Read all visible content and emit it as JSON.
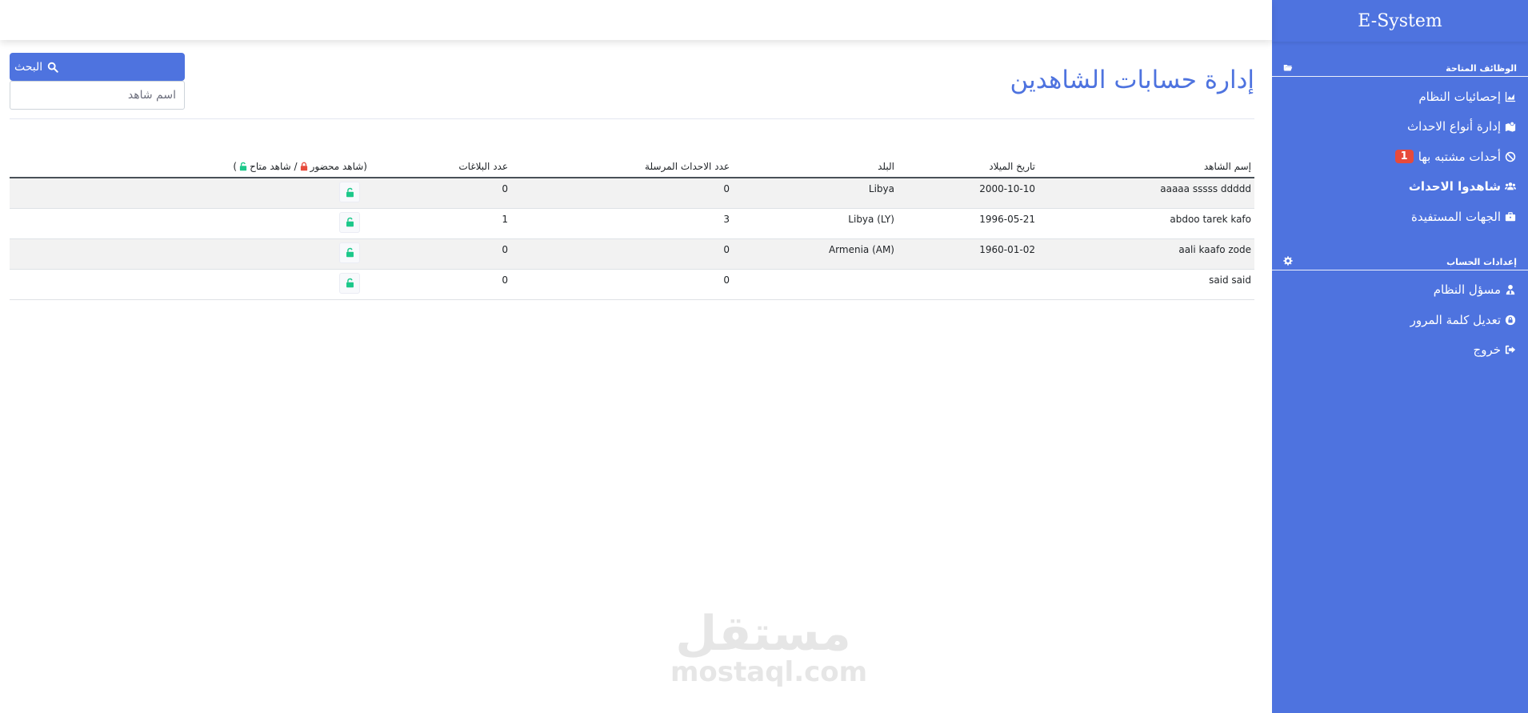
{
  "app": {
    "brand": "E-System"
  },
  "sidebar": {
    "section_functions": "الوظائف المتاحة",
    "items": [
      {
        "label": "إحصائيات النظام",
        "icon": "chart-area-icon"
      },
      {
        "label": "إدارة أنواع الاحداث",
        "icon": "map-marked-icon"
      },
      {
        "label": "أحدات مشتبه بها",
        "icon": "ban-icon",
        "badge": "1"
      },
      {
        "label": "شاهدوا الاحداث",
        "icon": "users-icon",
        "active": true
      },
      {
        "label": "الجهات المستفيدة",
        "icon": "briefcase-icon"
      }
    ],
    "section_account": "إعدادات الحساب",
    "account_items": [
      {
        "label": "مسؤل النظام",
        "icon": "user-tie-icon"
      },
      {
        "label": "تعديل كلمة المرور",
        "icon": "lock-circle-icon"
      },
      {
        "label": "خروج",
        "icon": "sign-out-icon"
      }
    ]
  },
  "page": {
    "title": "إدارة حسابات الشاهدين",
    "search_button": "البحث",
    "search_placeholder": "اسم شاهد"
  },
  "table": {
    "headers": {
      "name": "إسم الشاهد",
      "dob": "تاريخ الميلاد",
      "country": "البلد",
      "events": "عدد الاحداث المرسلة",
      "reports": "عدد البلاغات",
      "status_open": "(شاهد محضور",
      "status_sep": "/ شاهد متاح",
      "status_close": ")"
    },
    "rows": [
      {
        "name": "aaaaa sssss ddddd",
        "dob": "2000-10-10",
        "country": "Libya",
        "events": "0",
        "reports": "0",
        "status": "available"
      },
      {
        "name": "abdoo tarek kafo",
        "dob": "1996-05-21",
        "country": "Libya (LY)",
        "events": "3",
        "reports": "1",
        "status": "available"
      },
      {
        "name": "aali kaafo zode",
        "dob": "1960-01-02",
        "country": "Armenia (AM)",
        "events": "0",
        "reports": "0",
        "status": "available"
      },
      {
        "name": "said said",
        "dob": "",
        "country": "",
        "events": "0",
        "reports": "0",
        "status": "available"
      }
    ]
  },
  "watermark": {
    "arabic": "مستقل",
    "latin": "mostaql.com"
  },
  "colors": {
    "primary": "#4e73df",
    "danger": "#e74a3b",
    "success": "#1cc88a",
    "stripe": "#f2f2f2"
  }
}
